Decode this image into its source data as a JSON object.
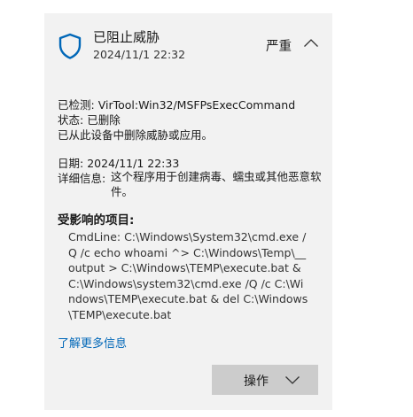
{
  "header": {
    "title": "已阻止威胁",
    "timestamp": "2024/11/1 22:32",
    "severity": "严重",
    "icon": "shield-icon",
    "accent_color": "#0067b8"
  },
  "summary": {
    "detected_label": "已检测:",
    "detected_value": "VirTool:Win32/MSFPsExecCommand",
    "status_label": "状态:",
    "status_value": "已删除",
    "message": "已从此设备中删除威胁或应用。"
  },
  "details": {
    "date_label": "日期:",
    "date_value": "2024/11/1 22:33",
    "info_label": "详细信息:",
    "info_value": "这个程序用于创建病毒、蠕虫或其他恶意软件。"
  },
  "affected": {
    "title": "受影响的项目:",
    "item": "CmdLine: C:\\Windows\\System32\\cmd.exe /Q /c echo whoami ^> C:\\Windows\\Temp\\__output > C:\\Windows\\TEMP\\execute.bat & C:\\Windows\\system32\\cmd.exe /Q /c C:\\Windows\\TEMP\\execute.bat & del C:\\Windows\\TEMP\\execute.bat"
  },
  "links": {
    "learn_more": "了解更多信息"
  },
  "actions": {
    "button_label": "操作"
  }
}
